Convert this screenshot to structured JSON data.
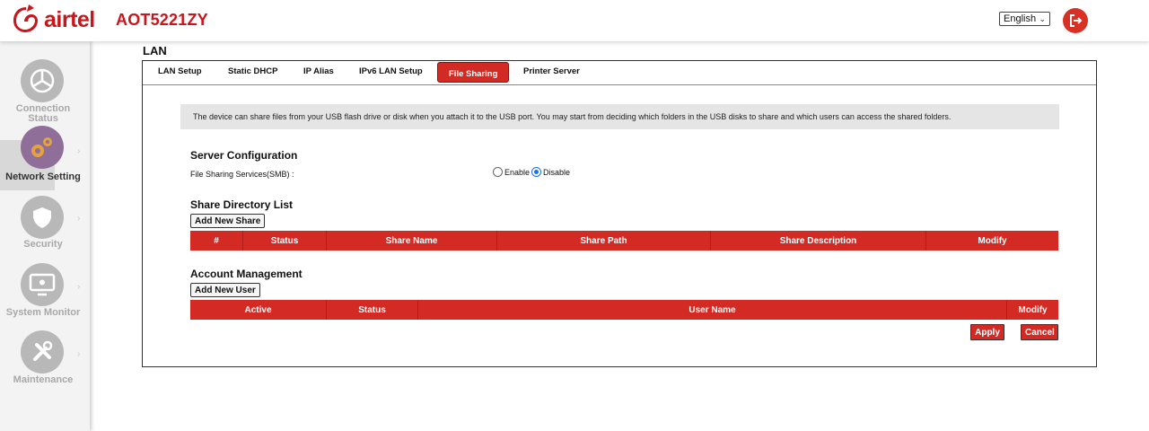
{
  "header": {
    "brand": "airtel",
    "device_name": "AOT5221ZY",
    "language": "English"
  },
  "sidebar": {
    "items": [
      {
        "label": "Connection Status",
        "icon": "pie-chart-icon",
        "active": false
      },
      {
        "label": "Network Setting",
        "icon": "gears-icon",
        "active": true
      },
      {
        "label": "Security",
        "icon": "shield-icon",
        "active": false
      },
      {
        "label": "System Monitor",
        "icon": "monitor-icon",
        "active": false
      },
      {
        "label": "Maintenance",
        "icon": "wrench-icon",
        "active": false
      }
    ]
  },
  "page": {
    "title": "LAN",
    "tabs": [
      "LAN Setup",
      "Static DHCP",
      "IP Alias",
      "IPv6 LAN Setup",
      "File Sharing",
      "Printer Server"
    ],
    "active_tab": "File Sharing",
    "info": "The device can share files from your USB flash drive or disk when you attach it to the USB port. You may start from deciding which folders in the USB disks to share and which users can access the shared folders."
  },
  "server_config": {
    "title": "Server Configuration",
    "smb_label": "File Sharing Services(SMB) :",
    "enable_label": "Enable",
    "disable_label": "Disable",
    "selected": "Disable"
  },
  "share_list": {
    "title": "Share Directory List",
    "add_button": "Add New Share",
    "columns": [
      "#",
      "Status",
      "Share Name",
      "Share Path",
      "Share Description",
      "Modify"
    ]
  },
  "account": {
    "title": "Account Management",
    "add_button": "Add New User",
    "columns": [
      "Active",
      "Status",
      "User Name",
      "Modify"
    ]
  },
  "actions": {
    "apply": "Apply",
    "cancel": "Cancel"
  },
  "colors": {
    "brand_red": "#c8161d",
    "table_red": "#d42a24",
    "logout_red": "#d93025"
  }
}
